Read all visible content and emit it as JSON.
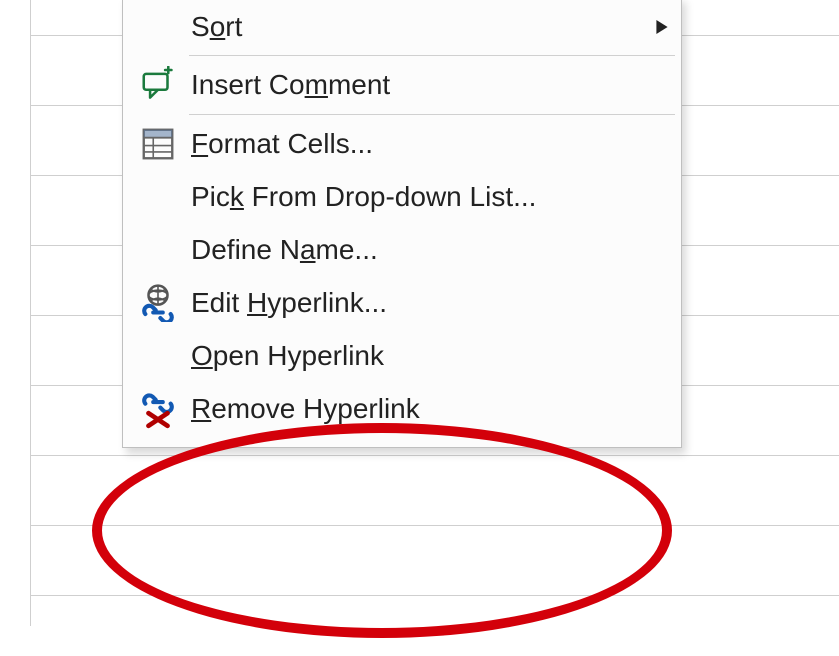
{
  "annotation": {
    "callout_color": "#d3000a"
  },
  "menu": {
    "sort": {
      "pre": "S",
      "mn": "o",
      "post": "rt",
      "has_submenu": true
    },
    "insert_comment": {
      "pre": "Insert Co",
      "mn": "m",
      "post": "ment"
    },
    "format_cells": {
      "pre": "",
      "mn": "F",
      "post": "ormat Cells..."
    },
    "pick_list": {
      "pre": "Pic",
      "mn": "k",
      "post": " From Drop-down List..."
    },
    "define_name": {
      "pre": "Define N",
      "mn": "a",
      "post": "me..."
    },
    "edit_hyperlink": {
      "pre": "Edit ",
      "mn": "H",
      "post": "yperlink..."
    },
    "open_hyperlink": {
      "pre": "",
      "mn": "O",
      "post": "pen Hyperlink"
    },
    "remove_hyperlink": {
      "pre": "",
      "mn": "R",
      "post": "emove Hyperlink"
    }
  }
}
